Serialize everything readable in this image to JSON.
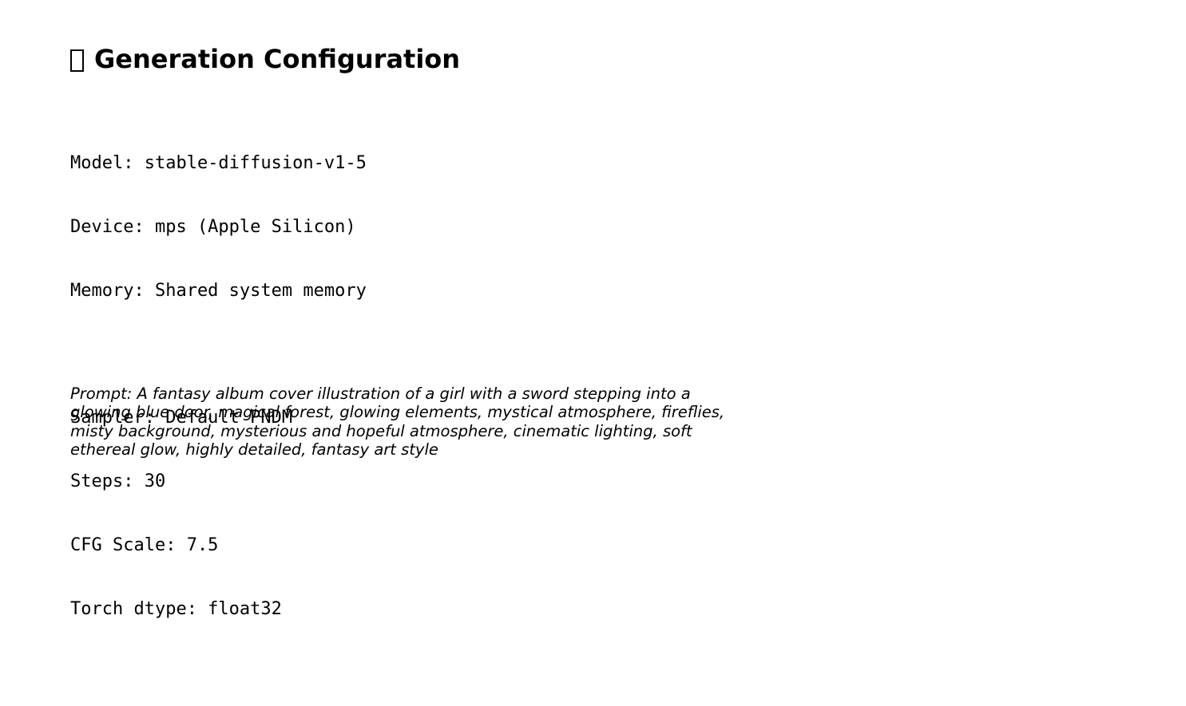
{
  "header": {
    "icon": "missing-glyph-icon",
    "title": "Generation Configuration"
  },
  "config": {
    "model": "Model: stable-diffusion-v1-5",
    "device": "Device: mps (Apple Silicon)",
    "memory": "Memory: Shared system memory",
    "sampler": "Sampler: Default PNDM",
    "steps": "Steps: 30",
    "cfg_scale": "CFG Scale: 7.5",
    "torch_dtype": "Torch dtype: float32"
  },
  "prompt": {
    "text": "Prompt: A fantasy album cover illustration of a girl with a sword stepping into a glowing blue door, magical forest, glowing elements, mystical atmosphere, fireflies, misty background, mysterious and hopeful atmosphere, cinematic lighting, soft ethereal glow, highly detailed, fantasy art style"
  }
}
